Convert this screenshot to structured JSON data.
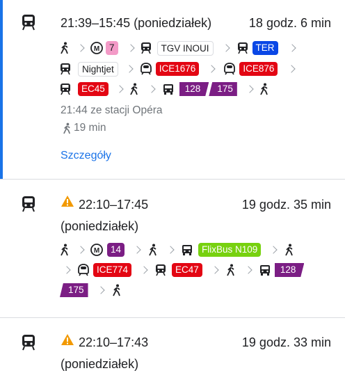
{
  "routes": [
    {
      "time": "21:39–15:45 (poniedziałek)",
      "duration": "18 godz. 6 min",
      "badges": {
        "metro": "7",
        "tgv": "TGV INOUI",
        "ter": "TER",
        "nightjet": "Nightjet",
        "ice1": "ICE1676",
        "ice2": "ICE876",
        "ec": "EC45",
        "bus1": "128",
        "bus2": "175"
      },
      "departure": "21:44 ze stacji Opéra",
      "walk": "19 min",
      "details_link": "Szczegóły",
      "colors": {
        "selected_bar": "#1a73e8"
      }
    },
    {
      "time_line1": "22:10–17:45",
      "time_line2": "(poniedziałek)",
      "duration": "19 godz. 35 min",
      "badges": {
        "metro": "14",
        "flixbus": "FlixBus N109",
        "ice": "ICE774",
        "ec": "EC47",
        "bus1": "128",
        "bus2": "175"
      }
    },
    {
      "time_line1": "22:10–17:43",
      "time_line2": "(poniedziałek)",
      "duration": "19 godz. 33 min"
    }
  ]
}
